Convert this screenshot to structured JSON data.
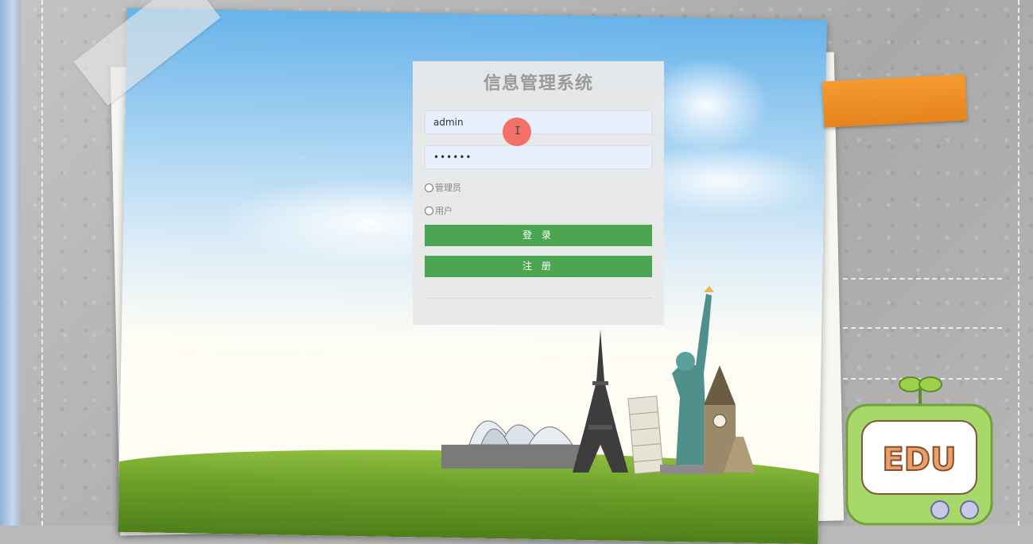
{
  "login": {
    "title": "信息管理系统",
    "username_value": "admin",
    "password_value": "••••••",
    "roles": [
      "管理员",
      "用户"
    ],
    "login_button": "登 录",
    "register_button": "注 册"
  },
  "badge": {
    "text": "EDU"
  },
  "cursor": {
    "glyph": "I"
  }
}
